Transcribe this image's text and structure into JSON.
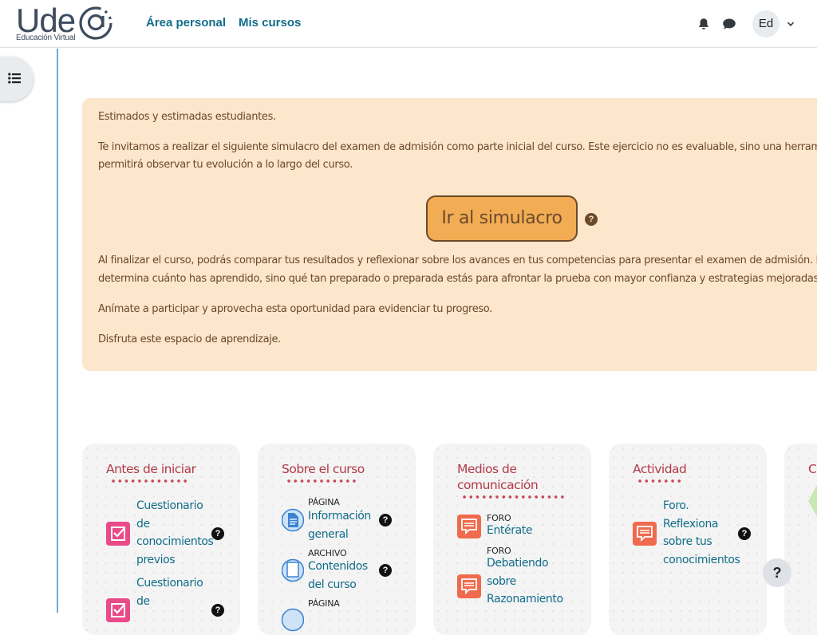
{
  "brand": {
    "logo_text": "Ude",
    "logo_subtitle": "Educación Virtual"
  },
  "nav": {
    "dashboard": "Área personal",
    "my_courses": "Mis cursos"
  },
  "user": {
    "initials": "Ed"
  },
  "notice": {
    "greeting": "Estimados y estimadas estudiantes.",
    "para1_line1": "Te invitamos a realizar el siguiente simulacro del examen de admisión como parte inicial del curso. Este ejercicio no es evaluable, sino una herramien",
    "para1_line2": "permitirá observar tu evolución a lo largo del curso.",
    "button": "Ir al simulacro",
    "para2_line1": "Al finalizar el curso, podrás comparar tus resultados y reflexionar sobre los avances en tus competencias para presentar el examen de admisión. Recuerd",
    "para2_line2": "determina cuánto has aprendido, sino qué tan preparado o preparada estás para afrontar la prueba con mayor confianza y estrategias mejoradas.",
    "para3": "Anímate a participar y aprovecha esta oportunidad para evidenciar tu progreso.",
    "para4": "Disfruta este espacio de aprendizaje."
  },
  "cards": [
    {
      "title": "Antes de iniciar",
      "items": [
        {
          "link_lines": [
            "Cuestionario",
            "de",
            "conocimientos",
            "previos"
          ]
        },
        {
          "link_lines": [
            "Cuestionario",
            "de"
          ]
        }
      ]
    },
    {
      "title": "Sobre el curso",
      "items": [
        {
          "type": "PÁGINA",
          "link_lines": [
            "Información",
            "general"
          ]
        },
        {
          "type": "ARCHIVO",
          "link_lines": [
            "Contenidos",
            "del curso"
          ]
        },
        {
          "type": "PÁGINA"
        }
      ]
    },
    {
      "title_lines": [
        "Medios de",
        "comunicación"
      ],
      "items": [
        {
          "type": "FORO",
          "link_lines": [
            "Entérate"
          ]
        },
        {
          "type": "FORO",
          "link_lines": [
            "Debatiendo",
            "sobre",
            "Razonamiento"
          ]
        }
      ]
    },
    {
      "title": "Actividad",
      "items": [
        {
          "link_lines": [
            "Foro.",
            "Reflexiona",
            "sobre tus",
            "conocimientos"
          ]
        }
      ]
    },
    {
      "title": "Co"
    }
  ],
  "help": {
    "symbol": "?"
  },
  "colors": {
    "link": "#116d8a",
    "notice_bg": "#fce6cc",
    "button_bg": "#f2ac54",
    "card_title": "#b23a48"
  }
}
